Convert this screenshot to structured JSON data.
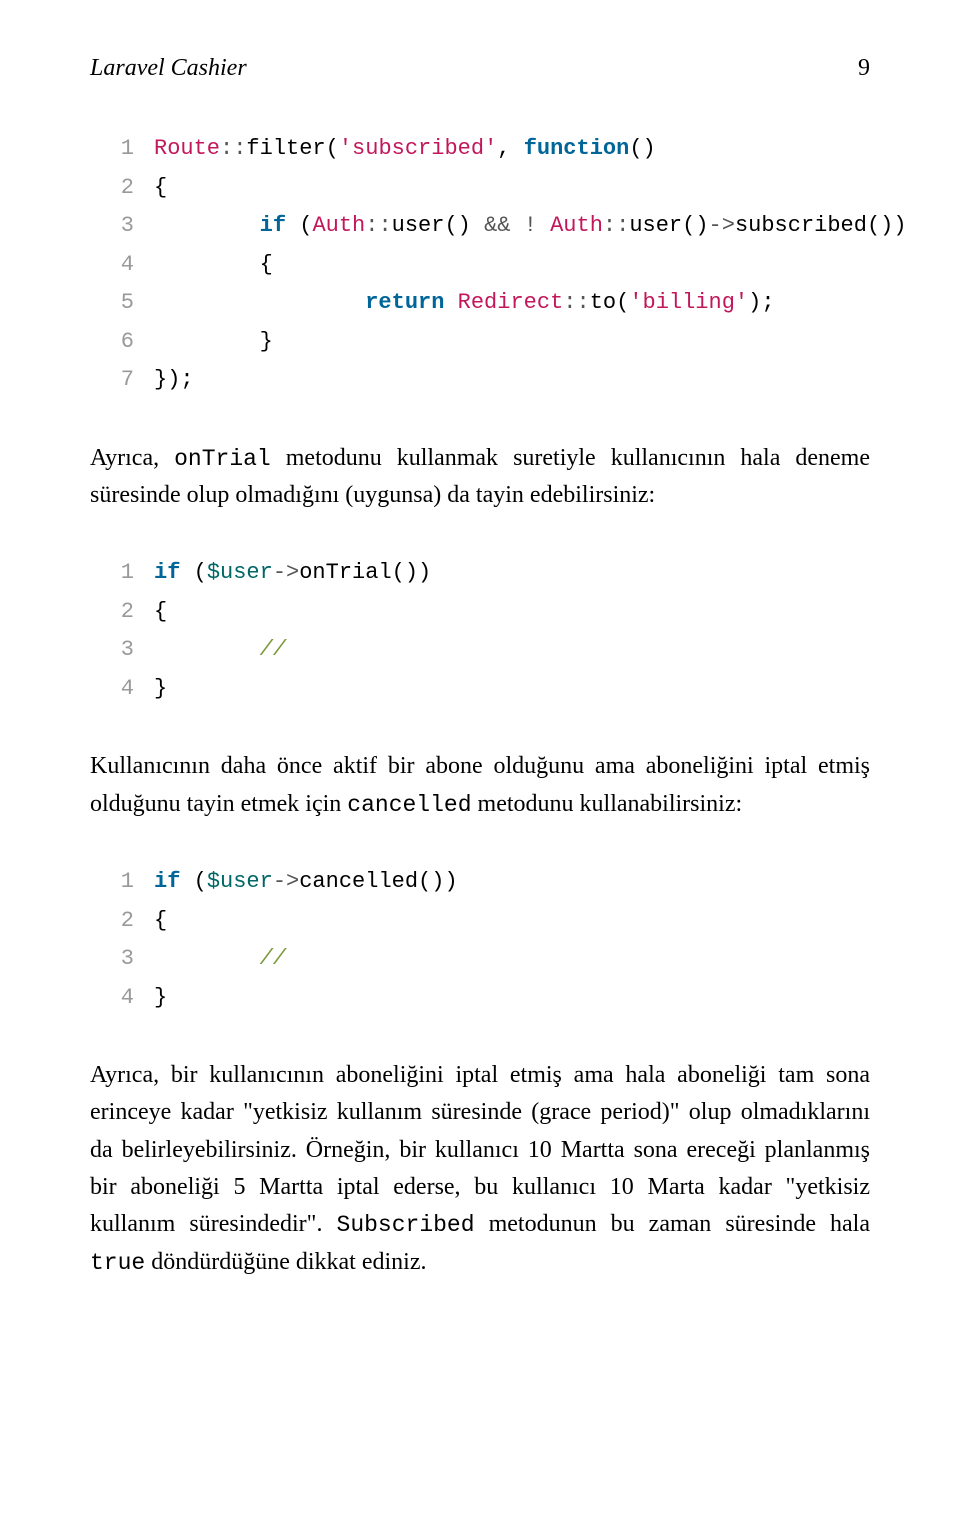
{
  "header": {
    "title": "Laravel Cashier",
    "page_number": "9"
  },
  "code1": {
    "lines": [
      {
        "n": "1",
        "parts": [
          {
            "t": "Route",
            "c": "fn"
          },
          {
            "t": "::",
            "c": "op"
          },
          {
            "t": "filter",
            "c": ""
          },
          {
            "t": "(",
            "c": ""
          },
          {
            "t": "'subscribed'",
            "c": "str"
          },
          {
            "t": ", ",
            "c": ""
          },
          {
            "t": "function",
            "c": "kw"
          },
          {
            "t": "()",
            "c": ""
          }
        ]
      },
      {
        "n": "2",
        "parts": [
          {
            "t": "{",
            "c": ""
          }
        ]
      },
      {
        "n": "3",
        "parts": [
          {
            "t": "        ",
            "c": ""
          },
          {
            "t": "if",
            "c": "kw"
          },
          {
            "t": " (",
            "c": ""
          },
          {
            "t": "Auth",
            "c": "fn"
          },
          {
            "t": "::",
            "c": "op"
          },
          {
            "t": "user() ",
            "c": ""
          },
          {
            "t": "&&",
            "c": "op"
          },
          {
            "t": " ",
            "c": ""
          },
          {
            "t": "!",
            "c": "op"
          },
          {
            "t": " ",
            "c": ""
          },
          {
            "t": "Auth",
            "c": "fn"
          },
          {
            "t": "::",
            "c": "op"
          },
          {
            "t": "user()",
            "c": ""
          },
          {
            "t": "->",
            "c": "op"
          },
          {
            "t": "subscribed())",
            "c": ""
          }
        ]
      },
      {
        "n": "4",
        "parts": [
          {
            "t": "        {",
            "c": ""
          }
        ]
      },
      {
        "n": "5",
        "parts": [
          {
            "t": "                ",
            "c": ""
          },
          {
            "t": "return",
            "c": "kw"
          },
          {
            "t": " ",
            "c": ""
          },
          {
            "t": "Redirect",
            "c": "fn"
          },
          {
            "t": "::",
            "c": "op"
          },
          {
            "t": "to(",
            "c": ""
          },
          {
            "t": "'billing'",
            "c": "str"
          },
          {
            "t": ");",
            "c": ""
          }
        ]
      },
      {
        "n": "6",
        "parts": [
          {
            "t": "        }",
            "c": ""
          }
        ]
      },
      {
        "n": "7",
        "parts": [
          {
            "t": "});",
            "c": ""
          }
        ]
      }
    ]
  },
  "para1": {
    "pre": "Ayrıca, ",
    "mono1": "onTrial",
    "post": " metodunu kullanmak suretiyle kullanıcının hala deneme süresinde olup olmadığını (uygunsa) da tayin edebilirsiniz:"
  },
  "code2": {
    "lines": [
      {
        "n": "1",
        "parts": [
          {
            "t": "if",
            "c": "kw"
          },
          {
            "t": " (",
            "c": ""
          },
          {
            "t": "$user",
            "c": "var"
          },
          {
            "t": "->",
            "c": "op"
          },
          {
            "t": "onTrial())",
            "c": ""
          }
        ]
      },
      {
        "n": "2",
        "parts": [
          {
            "t": "{",
            "c": ""
          }
        ]
      },
      {
        "n": "3",
        "parts": [
          {
            "t": "        ",
            "c": ""
          },
          {
            "t": "//",
            "c": "cmt"
          }
        ]
      },
      {
        "n": "4",
        "parts": [
          {
            "t": "}",
            "c": ""
          }
        ]
      }
    ]
  },
  "para2": {
    "pre": "Kullanıcının daha önce aktif bir abone olduğunu ama aboneliğini iptal etmiş olduğunu tayin etmek için ",
    "mono1": "cancelled",
    "post": " metodunu kullanabilirsiniz:"
  },
  "code3": {
    "lines": [
      {
        "n": "1",
        "parts": [
          {
            "t": "if",
            "c": "kw"
          },
          {
            "t": " (",
            "c": ""
          },
          {
            "t": "$user",
            "c": "var"
          },
          {
            "t": "->",
            "c": "op"
          },
          {
            "t": "cancelled())",
            "c": ""
          }
        ]
      },
      {
        "n": "2",
        "parts": [
          {
            "t": "{",
            "c": ""
          }
        ]
      },
      {
        "n": "3",
        "parts": [
          {
            "t": "        ",
            "c": ""
          },
          {
            "t": "//",
            "c": "cmt"
          }
        ]
      },
      {
        "n": "4",
        "parts": [
          {
            "t": "}",
            "c": ""
          }
        ]
      }
    ]
  },
  "para3": {
    "seg1": "Ayrıca, bir kullanıcının aboneliğini iptal etmiş ama hala aboneliği tam sona erinceye kadar \"yetkisiz kullanım süresinde (grace period)\" olup olmadıklarını da belirleyebilirsiniz. Örneğin, bir kullanıcı 10 Martta sona ereceği planlanmış bir aboneliği 5 Martta iptal ederse, bu kullanıcı 10 Marta kadar \"yetkisiz kullanım süresindedir\". ",
    "mono1": "Subscribed",
    "seg2": " metodunun bu zaman süresinde hala ",
    "mono2": "true",
    "seg3": " döndürdüğüne dikkat ediniz."
  }
}
